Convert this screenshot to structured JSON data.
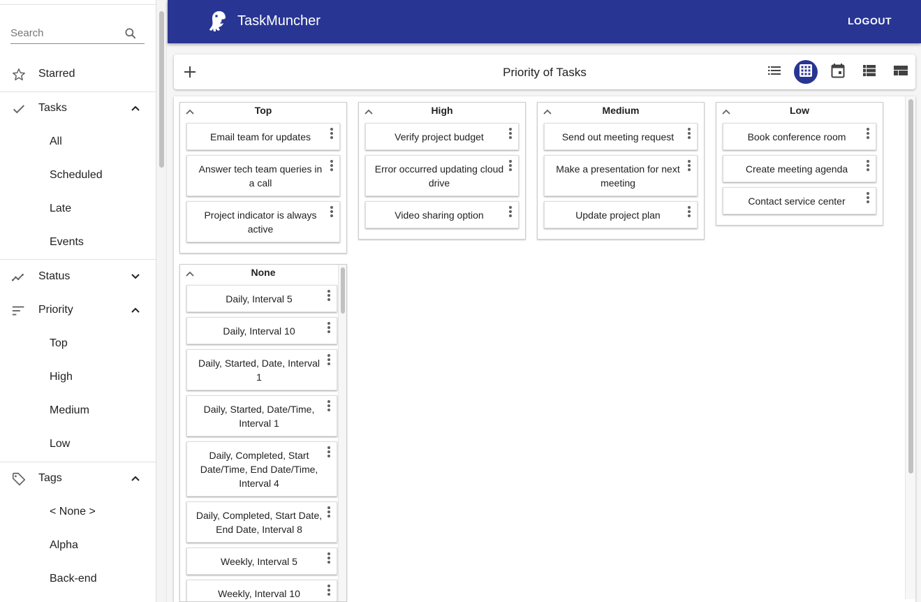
{
  "app": {
    "title": "TaskMuncher",
    "logout_label": "LOGOUT"
  },
  "sidebar": {
    "search": {
      "placeholder": "Search",
      "value": ""
    },
    "starred": "Starred",
    "tasks": {
      "label": "Tasks",
      "expanded": true,
      "items": [
        "All",
        "Scheduled",
        "Late",
        "Events"
      ]
    },
    "status": {
      "label": "Status",
      "expanded": false
    },
    "priority": {
      "label": "Priority",
      "expanded": true,
      "items": [
        "Top",
        "High",
        "Medium",
        "Low"
      ]
    },
    "tags": {
      "label": "Tags",
      "expanded": true,
      "items": [
        "< None >",
        "Alpha",
        "Back-end"
      ]
    }
  },
  "toolbar": {
    "title": "Priority of Tasks",
    "add_icon": "plus-icon",
    "views": [
      {
        "name": "list-view",
        "icon": "list-icon",
        "active": false
      },
      {
        "name": "grid-view",
        "icon": "grid-icon",
        "active": true
      },
      {
        "name": "calendar-view",
        "icon": "calendar-icon",
        "active": false
      },
      {
        "name": "detail-list-view",
        "icon": "view-list-icon",
        "active": false
      },
      {
        "name": "quilt-view",
        "icon": "view-quilt-icon",
        "active": false
      }
    ]
  },
  "board": {
    "lanes": [
      {
        "title": "Top",
        "cards": [
          "Email team for updates",
          "Answer tech team queries in a call",
          "Project indicator is always active"
        ]
      },
      {
        "title": "High",
        "cards": [
          "Verify project budget",
          "Error occurred updating cloud drive",
          "Video sharing option"
        ]
      },
      {
        "title": "Medium",
        "cards": [
          "Send out meeting request",
          "Make a presentation for next meeting",
          "Update project plan"
        ]
      },
      {
        "title": "Low",
        "cards": [
          "Book conference room",
          "Create meeting agenda",
          "Contact service center"
        ]
      },
      {
        "title": "None",
        "cards": [
          "Daily, Interval 5",
          "Daily, Interval 10",
          "Daily, Started, Date, Interval 1",
          "Daily, Started, Date/Time, Interval 1",
          "Daily, Completed, Start Date/Time, End Date/Time, Interval 4",
          "Daily, Completed, Start Date, End Date, Interval 8",
          "Weekly, Interval 5",
          "Weekly, Interval 10"
        ]
      }
    ]
  },
  "colors": {
    "primary": "#283593",
    "icon_gray": "#616161"
  }
}
